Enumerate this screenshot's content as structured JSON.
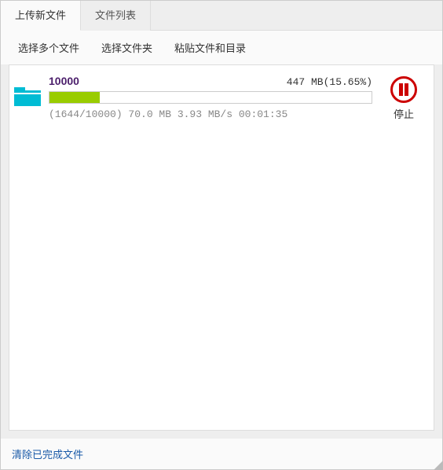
{
  "tabs": {
    "upload": "上传新文件",
    "list": "文件列表"
  },
  "toolbar": {
    "select_multiple": "选择多个文件",
    "select_folder": "选择文件夹",
    "paste_files": "粘贴文件和目录"
  },
  "upload": {
    "name": "10000",
    "size_text": "447 MB(15.65%)",
    "progress_percent": 15.65,
    "status_text": "(1644/10000) 70.0 MB 3.93 MB/s 00:01:35",
    "action_label": "停止"
  },
  "footer": {
    "clear_completed": "清除已完成文件"
  }
}
